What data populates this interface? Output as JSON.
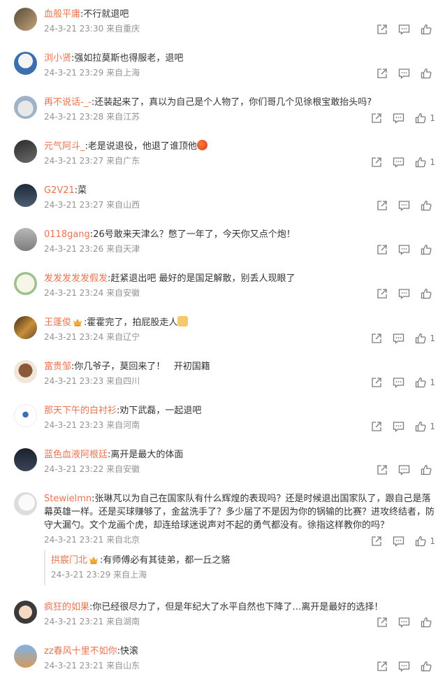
{
  "comments": [
    {
      "user": "血般平庸",
      "text": "不行就退吧",
      "time": "24-3-21 23:30",
      "loc": "来自重庆",
      "likes": ""
    },
    {
      "user": "浏小贤",
      "text": "强如拉莫斯也得服老，退吧",
      "time": "24-3-21 23:29",
      "loc": "来自上海",
      "likes": ""
    },
    {
      "user": "再不说话-_-",
      "text": "还装起来了，真以为自己是个人物了，你们哥几个见徐根宝敢抬头吗?",
      "time": "24-3-21 23:28",
      "loc": "来自江苏",
      "likes": "1"
    },
    {
      "user": "元气阿斗_",
      "text": "老是说退役，他退了谁顶他",
      "time": "24-3-21 23:27",
      "loc": "来自广东",
      "likes": "1"
    },
    {
      "user": "G2V21",
      "text": "菜",
      "time": "24-3-21 23:27",
      "loc": "来自山西",
      "likes": ""
    },
    {
      "user": "0118gang",
      "text": "26号敢来天津么？憋了一年了，今天你又点个炮！",
      "time": "24-3-21 23:26",
      "loc": "来自天津",
      "likes": ""
    },
    {
      "user": "发发发发发假发",
      "text": "赶紧退出吧 最好的是国足解散，别丢人现眼了",
      "time": "24-3-21 23:24",
      "loc": "来自安徽",
      "likes": ""
    },
    {
      "user": "王蓬俊",
      "text": "霍霍完了，拍屁股走人",
      "time": "24-3-21 23:24",
      "loc": "来自辽宁",
      "likes": "1"
    },
    {
      "user": "富贵邹",
      "text": "你几爷子，莫回来了！   开初国籍",
      "time": "24-3-21 23:23",
      "loc": "来自四川",
      "likes": "1"
    },
    {
      "user": "那天下午的白衬衫",
      "text": "劝下武磊，一起退吧",
      "time": "24-3-21 23:23",
      "loc": "来自河南",
      "likes": "1"
    },
    {
      "user": "蓝色血液阿根廷",
      "text": "离开是最大的体面",
      "time": "24-3-21 23:22",
      "loc": "来自安徽",
      "likes": ""
    },
    {
      "user": "Stewielmn",
      "text": "张琳芃以为自己在国家队有什么辉煌的表现吗？还是时候退出国家队了，跟自己是落幕英雄一样。还是买球赚够了，金盆洗手了？多少届了不是因为你的锅输的比赛？进攻终结者，防守大漏勺。文个龙画个虎，却连给球迷说声对不起的勇气都没有。徐指这样教你的吗？",
      "time": "24-3-21 23:21",
      "loc": "来自北京",
      "likes": "1",
      "reply": {
        "user": "拱宸门北",
        "text": "有师傅必有其徒弟，都一丘之貉",
        "time": "24-3-21 23:29",
        "loc": "来自上海"
      }
    },
    {
      "user": "疯狂的如果",
      "text": "你已经很尽力了，但是年纪大了水平自然也下降了…离开是最好的选择！",
      "time": "24-3-21 23:21",
      "loc": "来自湖南",
      "likes": ""
    },
    {
      "user": "zz春风十里不如你",
      "text": "快滚",
      "time": "24-3-21 23:21",
      "loc": "来自山东",
      "likes": ""
    }
  ],
  "colors": {
    "username": "#eb7350",
    "meta": "#939393",
    "icon": "#7a7a7a"
  },
  "icons": {
    "share": "share-icon",
    "comment": "comment-icon",
    "like": "thumbs-up-icon",
    "crown": "crown-badge-icon"
  }
}
